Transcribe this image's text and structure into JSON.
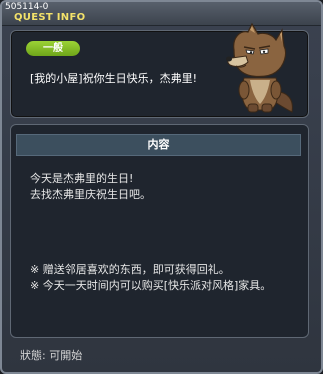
{
  "window": {
    "quest_id": "505114-0",
    "title": "QUEST INFO"
  },
  "header": {
    "badge": "一般",
    "quest_name": "[我的小屋]祝你生日快乐，杰弗里!",
    "mascot_icon": "wolf-mascot-icon"
  },
  "content": {
    "section_label": "内容",
    "description": [
      "今天是杰弗里的生日!",
      "去找杰弗里庆祝生日吧。"
    ],
    "notes": [
      "※ 赠送邻居喜欢的东西，即可获得回礼。",
      "※ 今天一天时间内可以购买[快乐派对风格]家具。"
    ]
  },
  "footer": {
    "status": "狀態: 可開始"
  },
  "colors": {
    "title": "#f3e26a",
    "badge": "#8bc42b",
    "panel": "#1f252e",
    "section_header": "#3c4f5e"
  }
}
